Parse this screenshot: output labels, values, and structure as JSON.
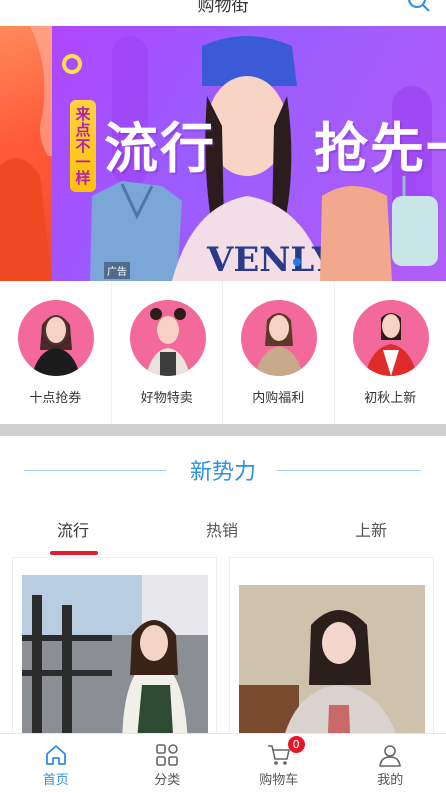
{
  "header": {
    "title": "购物街"
  },
  "banner": {
    "tag_text": "来点不一样",
    "headline_left": "流行",
    "headline_right": "抢先一步",
    "ad_label": "广告",
    "bg_color": "#a552ff"
  },
  "categories": [
    {
      "label": "十点抢券"
    },
    {
      "label": "好物特卖"
    },
    {
      "label": "内购福利"
    },
    {
      "label": "初秋上新"
    }
  ],
  "section": {
    "title": "新势力"
  },
  "tabs": [
    {
      "label": "流行",
      "active": true
    },
    {
      "label": "热销",
      "active": false
    },
    {
      "label": "上新",
      "active": false
    }
  ],
  "bottom_nav": [
    {
      "label": "首页",
      "icon": "home-icon",
      "active": true
    },
    {
      "label": "分类",
      "icon": "grid-icon",
      "active": false
    },
    {
      "label": "购物车",
      "icon": "cart-icon",
      "active": false,
      "badge": "0"
    },
    {
      "label": "我的",
      "icon": "user-icon",
      "active": false
    }
  ],
  "colors": {
    "accent": "#2f8fe0",
    "tab_indicator": "#e01e2e",
    "badge": "#e8162b",
    "avatar_bg": "#f4699b"
  }
}
